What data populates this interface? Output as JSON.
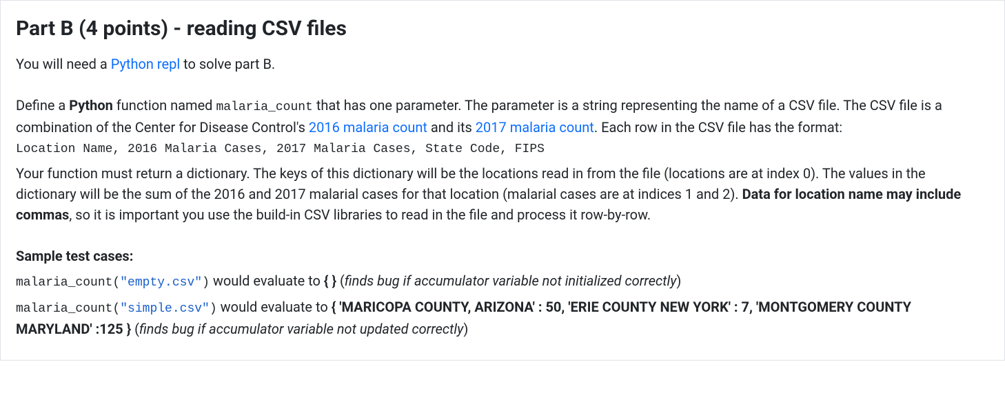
{
  "heading": "Part B (4 points) - reading CSV files",
  "intro": {
    "pre": "You will need a ",
    "link": "Python repl",
    "post": " to solve part B."
  },
  "para": {
    "t1": "Define a ",
    "python_bold": "Python",
    "t2": " function named ",
    "func_name": "malaria_count",
    "t3": " that has one parameter. The parameter is a string representing the name of a CSV file. The CSV file is a combination of the Center for Disease Control's ",
    "link1": "2016 malaria count",
    "t4": " and its ",
    "link2": "2017 malaria count",
    "t5": ". Each row in the CSV file has the format:",
    "format_line": "Location Name,  2016 Malaria Cases,  2017 Malaria Cases,  State Code,  FIPS",
    "t6": "Your function must return a dictionary. The keys of this dictionary will be the locations read in from the file (locations are at index 0). The values in the dictionary will be the sum of the 2016 and 2017 malarial cases for that location (malarial cases are at indices 1 and 2). ",
    "warn_bold": "Data for location name may include commas",
    "t7": ", so it is important you use the build-in CSV libraries to read in the file and process it row-by-row."
  },
  "sample": {
    "heading": "Sample test cases:",
    "case1": {
      "call_pre": "malaria_count(",
      "arg": "\"empty.csv\"",
      "call_post": ")",
      "mid": " would evaluate to ",
      "result": "{ }",
      "note_pre": " (",
      "note_em": "finds bug if accumulator variable not initialized correctly",
      "note_post": ")"
    },
    "case2": {
      "call_pre": "malaria_count(",
      "arg": "\"simple.csv\"",
      "call_post": ")",
      "mid": " would evaluate to ",
      "result": "{ 'MARICOPA COUNTY, ARIZONA' : 50, 'ERIE COUNTY NEW YORK' : 7, 'MONTGOMERY COUNTY MARYLAND' :125 }",
      "note_pre": " (",
      "note_em": "finds bug if accumulator variable not updated correctly",
      "note_post": ")"
    }
  }
}
